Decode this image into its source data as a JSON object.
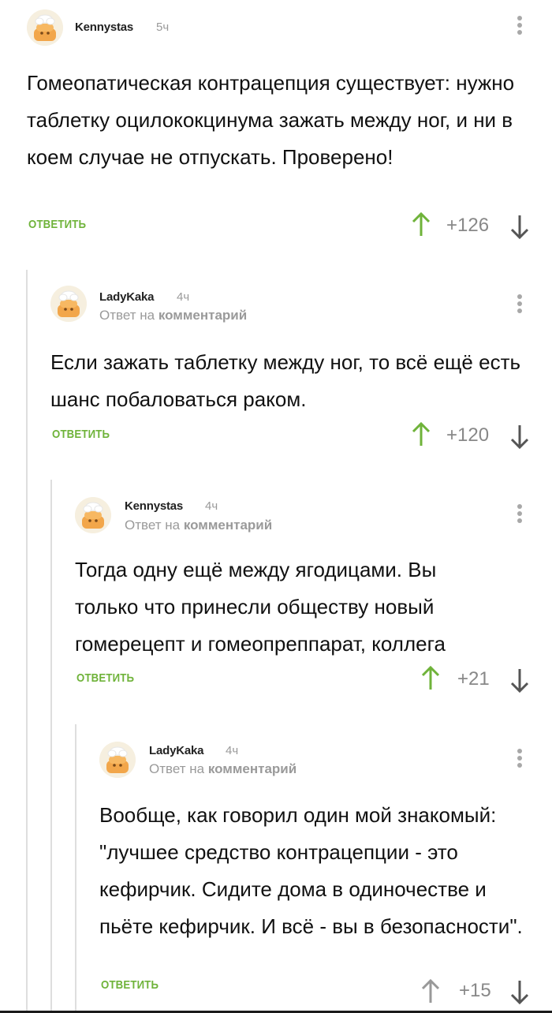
{
  "comments": [
    {
      "username": "Kennystas",
      "time": "5ч",
      "reply_prefix": "",
      "reply_target": "",
      "text": "Гомеопатическая контрацепция существует: нужно таблетку оцилококцинума зажать между ног, и ни в коем случае не отпускать. Проверено!",
      "reply_label": "ОТВЕТИТЬ",
      "rating": "+126",
      "upvoted": true
    },
    {
      "username": "LadyKaka",
      "time": "4ч",
      "reply_prefix": "Ответ на",
      "reply_target": "комментарий",
      "text": "Если зажать таблетку между ног, то всё ещё есть шанс побаловаться раком.",
      "reply_label": "ОТВЕТИТЬ",
      "rating": "+120",
      "upvoted": true
    },
    {
      "username": "Kennystas",
      "time": "4ч",
      "reply_prefix": "Ответ на",
      "reply_target": "комментарий",
      "text": "Тогда одну ещё между ягодицами. Вы только что принесли обществу новый гомерецепт и гомеопреппарат, коллега",
      "reply_label": "ОТВЕТИТЬ",
      "rating": "+21",
      "upvoted": true
    },
    {
      "username": "LadyKaka",
      "time": "4ч",
      "reply_prefix": "Ответ на",
      "reply_target": "комментарий",
      "text": "Вообще, как говорил один мой знакомый: \"лучшее средство контрацепции - это кефирчик. Сидите дома в одиночестве и пьёте кефирчик. И всё - вы в безопасности\".",
      "reply_label": "ОТВЕТИТЬ",
      "rating": "+15",
      "upvoted": false
    }
  ],
  "colors": {
    "accent": "#6fb33a",
    "muted": "#9a9a9a",
    "arrow_dark": "#555555",
    "arrow_neutral": "#999999"
  },
  "icons": {
    "avatar": "default-avatar-icon",
    "more": "more-vertical-icon",
    "upvote": "arrow-up-icon",
    "downvote": "arrow-down-icon"
  }
}
